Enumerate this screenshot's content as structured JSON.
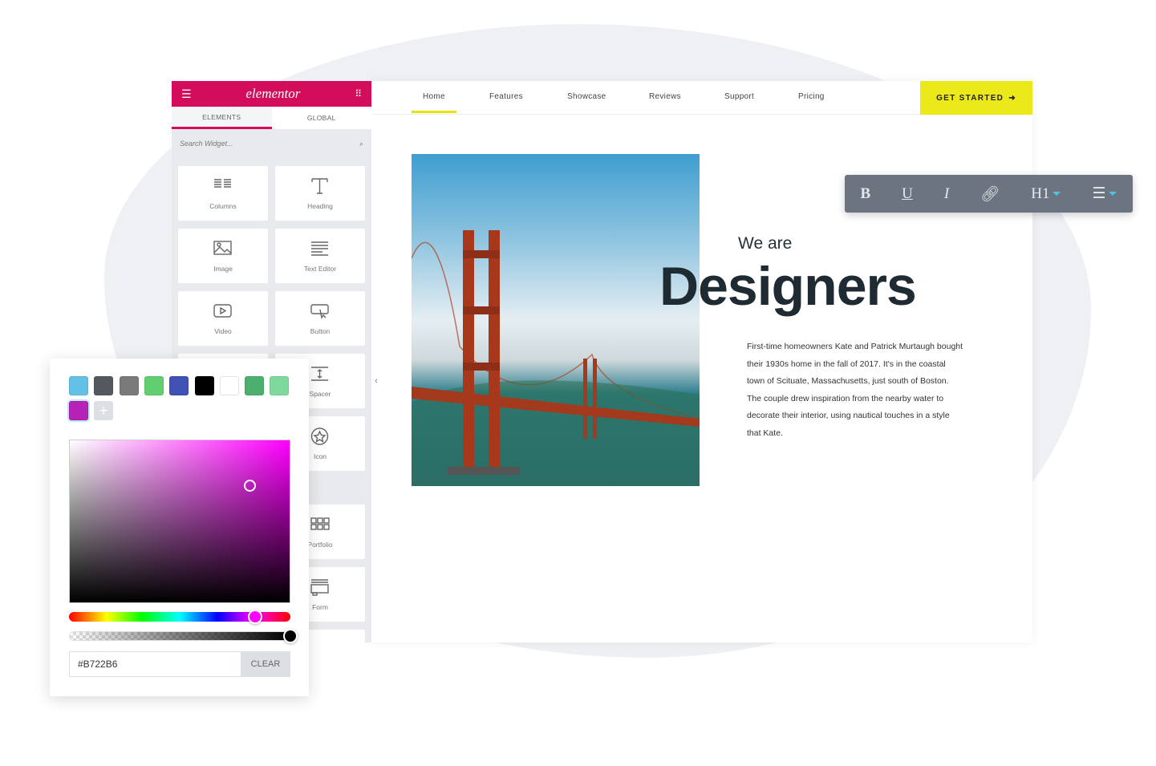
{
  "panel": {
    "brand": "elementor",
    "brand_color": "#d30c5c",
    "tabs": [
      "ELEMENTS",
      "GLOBAL"
    ],
    "search_placeholder": "Search Widget...",
    "widgets": [
      {
        "label": "Columns",
        "icon": "columns-icon"
      },
      {
        "label": "Heading",
        "icon": "heading-icon"
      },
      {
        "label": "Image",
        "icon": "image-icon"
      },
      {
        "label": "Text Editor",
        "icon": "text-editor-icon"
      },
      {
        "label": "Video",
        "icon": "video-icon"
      },
      {
        "label": "Button",
        "icon": "button-icon"
      },
      {
        "label": "Spacer",
        "icon": "spacer-icon"
      },
      {
        "label": "Icon",
        "icon": "star-icon"
      },
      {
        "label": "Portfolio",
        "icon": "portfolio-icon"
      },
      {
        "label": "Form",
        "icon": "form-icon"
      }
    ]
  },
  "site": {
    "nav": [
      "Home",
      "Features",
      "Showcase",
      "Reviews",
      "Support",
      "Pricing"
    ],
    "active_nav": "Home",
    "cta": "GET STARTED",
    "cta_color": "#ece91a",
    "eyebrow": "We are",
    "headline": "Designers",
    "paragraph": "First-time homeowners Kate and Patrick Murtaugh bought their 1930s home in the fall of 2017. It's in the coastal town of Scituate, Massachusetts, just south of Boston. The couple drew inspiration from the nearby water to decorate their interior, using nautical touches in a style that Kate."
  },
  "toolbar": {
    "bold": "B",
    "underline": "U",
    "italic": "I",
    "heading": "H1"
  },
  "picker": {
    "swatches": [
      "#62c1e5",
      "#54595f",
      "#7a7a7a",
      "#61ce70",
      "#3f51b5",
      "#000000",
      "#ffffff",
      "#4caf6e",
      "#7fd89c",
      "#b722b6"
    ],
    "hex": "#B722B6",
    "clear_label": "CLEAR",
    "hue_percent": 84,
    "alpha_percent": 100
  }
}
